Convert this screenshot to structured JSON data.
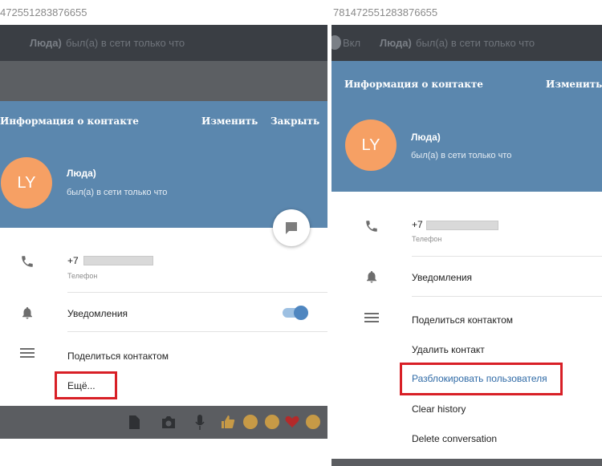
{
  "left": {
    "url": "472551283876655",
    "topbar": {
      "name": "Люда)",
      "status": "был(а) в сети только что"
    },
    "header": {
      "title": "Информация о контакте",
      "edit": "Изменить",
      "close": "Закрыть",
      "avatar_initials": "LY",
      "name": "Люда)",
      "status": "был(а) в сети только что"
    },
    "phone": {
      "value": "+7",
      "label": "Телефон"
    },
    "notifications": {
      "label": "Уведомления",
      "enabled": true
    },
    "share": "Поделиться контактом",
    "more": "Ещё..."
  },
  "right": {
    "url": "781472551283876655",
    "topbar": {
      "left": "Вкл",
      "name": "Люда)",
      "status": "был(а) в сети только что"
    },
    "header": {
      "title": "Информация о контакте",
      "edit": "Изменить",
      "avatar_initials": "LY",
      "name": "Люда)",
      "status": "был(а) в сети только что"
    },
    "phone": {
      "value": "+7",
      "label": "Телефон"
    },
    "notifications": {
      "label": "Уведомления"
    },
    "share": "Поделиться контактом",
    "delete": "Удалить контакт",
    "unblock": "Разблокировать пользователя",
    "clear_history": "Clear history",
    "delete_conversation": "Delete conversation"
  },
  "colors": {
    "header": "#5b87ae",
    "avatar": "#f6a064",
    "highlight": "#d81f26",
    "link": "#2f6aa6",
    "toggle": "#4f86c0"
  },
  "icons": [
    "phone-icon",
    "bell-icon",
    "menu-icon",
    "chat-bubble-icon",
    "attach-file-icon",
    "camera-icon",
    "mic-icon",
    "thumbs-up-icon",
    "emoji-icon",
    "heart-icon"
  ]
}
